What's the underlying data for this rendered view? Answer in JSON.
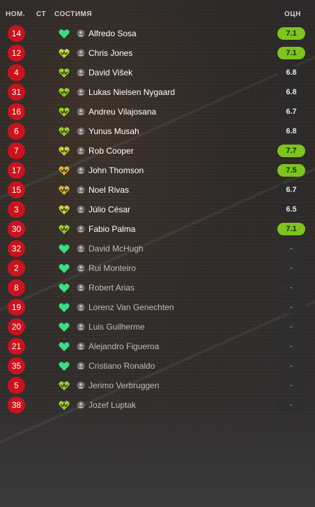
{
  "header": {
    "num_label": "НОМ.",
    "st_label": "СТ",
    "condition_label": "СОСТИМЯ",
    "rating_label": "ОЦН"
  },
  "colors": {
    "number_badge": "#c8141e",
    "rating_green": "#7ec31f",
    "heart_green": "#3ddc84",
    "heart_yellow_green": "#9ccc2a",
    "heart_yellow": "#cdd33a",
    "heart_gold": "#d9b13a"
  },
  "players": [
    {
      "number": "14",
      "name": "Alfredo Sosa",
      "rating": "7.1",
      "rating_style": "green",
      "condition_icon": "heart-green-icon",
      "heart_color": "#3ddc84",
      "active": true
    },
    {
      "number": "12",
      "name": "Chris Jones",
      "rating": "7.1",
      "rating_style": "green",
      "condition_icon": "heart-yellow-icon",
      "heart_color": "#cdd33a",
      "active": true
    },
    {
      "number": "4",
      "name": "David Višek",
      "rating": "6.8",
      "rating_style": "dark",
      "condition_icon": "heart-yellow-green-icon",
      "heart_color": "#9ccc2a",
      "active": true
    },
    {
      "number": "31",
      "name": "Lukas Nielsen Nygaard",
      "rating": "6.8",
      "rating_style": "dark",
      "condition_icon": "heart-yellow-green-icon",
      "heart_color": "#9ccc2a",
      "active": true
    },
    {
      "number": "16",
      "name": "Andreu Vilajosana",
      "rating": "6.7",
      "rating_style": "dark",
      "condition_icon": "heart-yellow-green-icon",
      "heart_color": "#9ccc2a",
      "active": true
    },
    {
      "number": "6",
      "name": "Yunus Musah",
      "rating": "6.8",
      "rating_style": "dark",
      "condition_icon": "heart-yellow-green-icon",
      "heart_color": "#9ccc2a",
      "active": true
    },
    {
      "number": "7",
      "name": "Rob Cooper",
      "rating": "7.7",
      "rating_style": "green",
      "condition_icon": "heart-yellow-icon",
      "heart_color": "#cdd33a",
      "active": true
    },
    {
      "number": "17",
      "name": "John Thomson",
      "rating": "7.5",
      "rating_style": "green",
      "condition_icon": "heart-gold-icon",
      "heart_color": "#d9b13a",
      "active": true
    },
    {
      "number": "15",
      "name": "Noel Rivas",
      "rating": "6.7",
      "rating_style": "dark",
      "condition_icon": "heart-gold-icon",
      "heart_color": "#d9b13a",
      "active": true
    },
    {
      "number": "3",
      "name": "Júlio César",
      "rating": "6.5",
      "rating_style": "dark",
      "condition_icon": "heart-yellow-icon",
      "heart_color": "#cdd33a",
      "active": true
    },
    {
      "number": "30",
      "name": "Fabio Palma",
      "rating": "7.1",
      "rating_style": "green",
      "condition_icon": "heart-yellow-green-icon",
      "heart_color": "#9ccc2a",
      "active": true
    },
    {
      "number": "32",
      "name": "David McHugh",
      "rating": "-",
      "rating_style": "none",
      "condition_icon": "heart-green-icon",
      "heart_color": "#3ddc84",
      "active": false
    },
    {
      "number": "2",
      "name": "Rui Monteiro",
      "rating": "-",
      "rating_style": "none",
      "condition_icon": "heart-green-icon",
      "heart_color": "#3ddc84",
      "active": false
    },
    {
      "number": "8",
      "name": "Robert Arias",
      "rating": "-",
      "rating_style": "none",
      "condition_icon": "heart-green-icon",
      "heart_color": "#3ddc84",
      "active": false
    },
    {
      "number": "19",
      "name": "Lorenz Van Genechten",
      "rating": "-",
      "rating_style": "none",
      "condition_icon": "heart-green-icon",
      "heart_color": "#3ddc84",
      "active": false
    },
    {
      "number": "20",
      "name": "Luis Guilherme",
      "rating": "-",
      "rating_style": "none",
      "condition_icon": "heart-green-icon",
      "heart_color": "#3ddc84",
      "active": false
    },
    {
      "number": "21",
      "name": "Alejandro Figueroa",
      "rating": "-",
      "rating_style": "none",
      "condition_icon": "heart-green-icon",
      "heart_color": "#3ddc84",
      "active": false
    },
    {
      "number": "35",
      "name": "Cristiano Ronaldo",
      "rating": "-",
      "rating_style": "none",
      "condition_icon": "heart-green-icon",
      "heart_color": "#3ddc84",
      "active": false
    },
    {
      "number": "5",
      "name": "Jerimo Verbruggen",
      "rating": "-",
      "rating_style": "none",
      "condition_icon": "heart-yellow-green-icon",
      "heart_color": "#9ccc2a",
      "active": false
    },
    {
      "number": "38",
      "name": "Jozef Luptak",
      "rating": "-",
      "rating_style": "none",
      "condition_icon": "heart-yellow-green-icon",
      "heart_color": "#9ccc2a",
      "active": false
    }
  ]
}
